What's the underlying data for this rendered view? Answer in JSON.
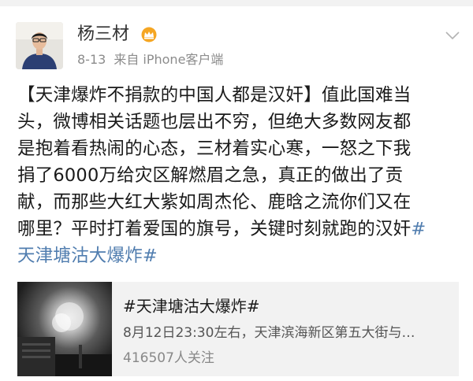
{
  "post": {
    "user": {
      "name": "杨三材",
      "badge_icon": "crown-vip-icon",
      "badge_color": "#f5a623"
    },
    "time": "8-13",
    "source": "来自 iPhone客户端",
    "text": {
      "line1": "【天津爆炸不捐款的中国人都是汉奸】值此国难当",
      "line2": "头，微博相关话题也层出不穷，但绝大多数网友都",
      "line3": "是抱着看热闹的心态，三材着实心寒，一怒之下我",
      "line4": "捐了6000万给灾区解燃眉之急，真正的做出了贡",
      "line5": "献，而那些大红大紫如周杰伦、鹿晗之流你们又在",
      "line6_text": "哪里？平时打着爱国的旗号，关键时刻就跑的汉奸",
      "hashtag_start": "#",
      "line7_hashtag": "天津塘沽大爆炸#"
    },
    "link_card": {
      "title": "#天津塘沽大爆炸#",
      "description": "8月12日23:30左右，天津滨海新区第五大街与…",
      "followers": "416507人关注"
    }
  },
  "colors": {
    "link": "#507daf",
    "meta": "#8c8c8c",
    "card_bg": "#f2f2f2"
  }
}
